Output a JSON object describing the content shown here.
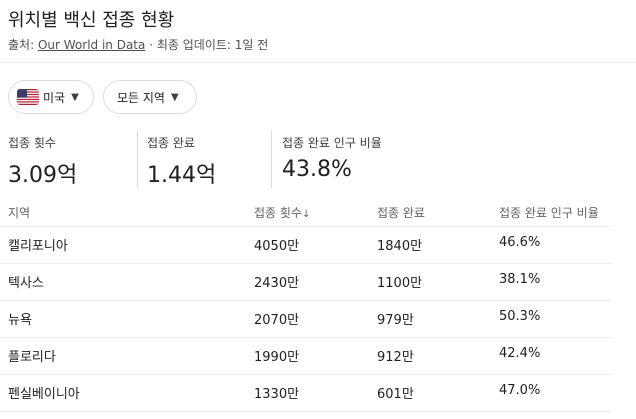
{
  "title": "위치별 백신 접종 현황",
  "source": {
    "prefix": "출처:",
    "link": "Our World in Data",
    "separator": "·",
    "updated": "최종 업데이트: 1일 전"
  },
  "filters": {
    "country": "미국",
    "region": "모든 지역"
  },
  "stats": [
    {
      "label": "접종 횟수",
      "value": "3.09억"
    },
    {
      "label": "접종 완료",
      "value": "1.44억"
    },
    {
      "label": "접종 완료 인구 비율",
      "value": "43.8%"
    }
  ],
  "table": {
    "headers": [
      "지역",
      "접종 횟수",
      "접종 완료",
      "접종 완료 인구 비율"
    ],
    "rows": [
      [
        "캘리포니아",
        "4050만",
        "1840만",
        "46.6%"
      ],
      [
        "텍사스",
        "2430만",
        "1100만",
        "38.1%"
      ],
      [
        "뉴욕",
        "2070만",
        "979만",
        "50.3%"
      ],
      [
        "플로리다",
        "1990만",
        "912만",
        "42.4%"
      ],
      [
        "펜실베이니아",
        "1330만",
        "601만",
        "47.0%"
      ]
    ]
  },
  "icons": {
    "flag": "us-flag-icon",
    "dropdown": "caret-down-icon",
    "sort": "arrow-down-icon"
  },
  "colors": {
    "text": "#202124",
    "secondary": "#5f6368",
    "border": "#dadce0"
  }
}
